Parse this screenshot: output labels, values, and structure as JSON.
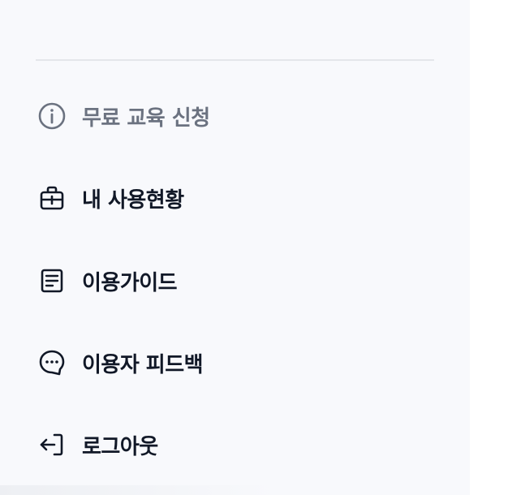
{
  "menu": {
    "items": [
      {
        "label": "무료 교육 신청",
        "icon": "info-icon",
        "color": "#6b7280"
      },
      {
        "label": "내 사용현황",
        "icon": "briefcase-icon",
        "color": "#111827"
      },
      {
        "label": "이용가이드",
        "icon": "document-icon",
        "color": "#111827"
      },
      {
        "label": "이용자 피드백",
        "icon": "chat-bubble-icon",
        "color": "#111827"
      },
      {
        "label": "로그아웃",
        "icon": "logout-icon",
        "color": "#111827"
      }
    ]
  }
}
